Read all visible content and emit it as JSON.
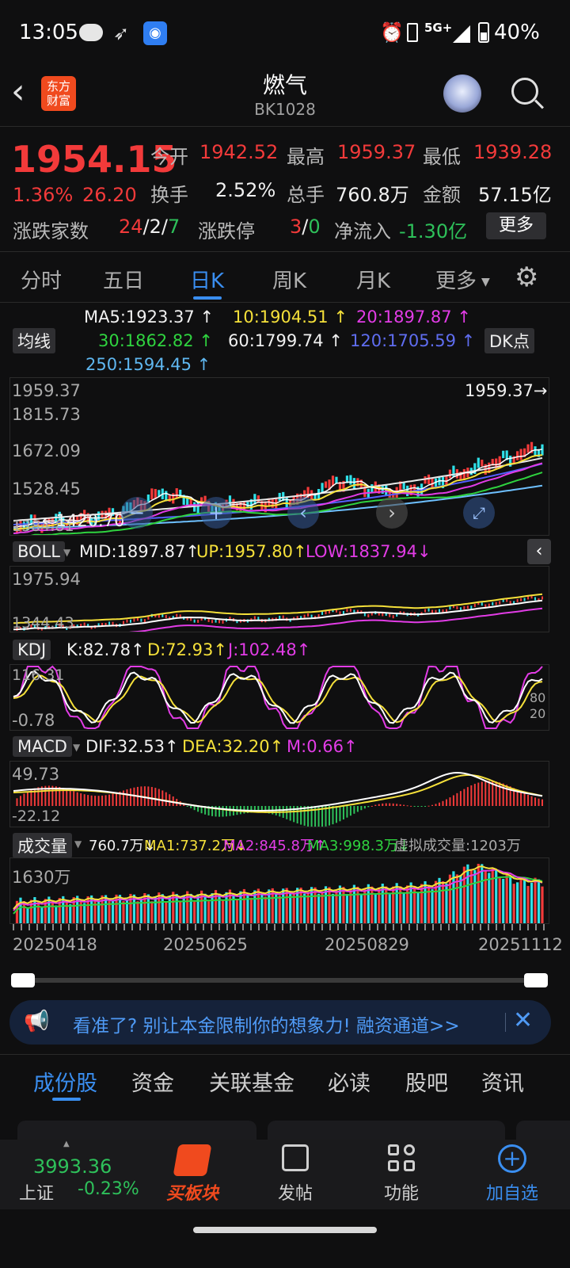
{
  "status_bar": {
    "time": "13:05",
    "network": "5G+",
    "battery": "40%"
  },
  "header": {
    "title": "燃气",
    "code": "BK1028",
    "logo_text_1": "东方",
    "logo_text_2": "财富"
  },
  "quote": {
    "price": "1954.15",
    "change_pct": "1.36%",
    "change": "26.20",
    "open_label": "今开",
    "open": "1942.52",
    "high_label": "最高",
    "high": "1959.37",
    "low_label": "最低",
    "low": "1939.28",
    "turnover_label": "换手",
    "turnover": "2.52%",
    "volume_label": "总手",
    "volume": "760.8万",
    "amount_label": "金额",
    "amount": "57.15亿",
    "breadth_label": "涨跌家数",
    "up": "24",
    "flat": "2",
    "down": "7",
    "limit_label": "涨跌停",
    "limit_up": "3",
    "limit_down": "0",
    "netflow_label": "净流入",
    "netflow": "-1.30亿",
    "more_label": "更多"
  },
  "period_tabs": [
    "分时",
    "五日",
    "日K",
    "周K",
    "月K",
    "更多"
  ],
  "active_tab": "日K",
  "ma_panel": {
    "toggle": "均线",
    "dk": "DK点",
    "ma5": "MA5:1923.37",
    "ma10": "10:1904.51",
    "ma20": "20:1897.87",
    "ma30": "30:1862.82",
    "ma60": "60:1799.74",
    "ma120": "120:1705.59",
    "ma250": "250:1594.45",
    "y_labels": [
      "1959.37",
      "1815.73",
      "1672.09",
      "1528.45",
      "1384.81"
    ],
    "high_mark": "1959.37",
    "low_mark": "1420.70"
  },
  "boll": {
    "name": "BOLL",
    "mid": "MID:1897.87",
    "up": "UP:1957.80",
    "low": "LOW:1837.94",
    "y_top": "1975.94",
    "y_bottom": "1344.43"
  },
  "kdj": {
    "name": "KDJ",
    "k": "K:82.78",
    "d": "D:72.93",
    "j": "J:102.48",
    "y_top": "116.31",
    "y_bottom": "-0.78",
    "r1": "80",
    "r2": "20"
  },
  "macd": {
    "name": "MACD",
    "dif": "DIF:32.53",
    "dea": "DEA:32.20",
    "m": "M:0.66",
    "y_top": "49.73",
    "y_bottom": "-22.12"
  },
  "volume": {
    "name": "成交量",
    "vol": "760.7万",
    "ma1": "MA1:737.2万",
    "ma2": "MA2:845.8万",
    "ma3": "MA3:998.3万",
    "virtual": "虚拟成交量:1203万",
    "y_top": "1630万"
  },
  "dates": [
    "20250418",
    "20250625",
    "20250829",
    "20251112"
  ],
  "banner": {
    "text": "看准了? 别让本金限制你的想象力! 融资通道>>"
  },
  "bottom_tabs": [
    "成份股",
    "资金",
    "关联基金",
    "必读",
    "股吧",
    "资讯"
  ],
  "active_bottom_tab": "成份股",
  "nav": {
    "index_value": "3993.36",
    "index_name": "上证",
    "index_change": "-0.23%",
    "buy_label": "买板块",
    "post_label": "发帖",
    "func_label": "功能",
    "add_label": "加自选"
  },
  "colors": {
    "up": "#f23a3a",
    "down": "#2ec05a",
    "accent": "#3a8ef0",
    "bg": "#0f0f10"
  }
}
